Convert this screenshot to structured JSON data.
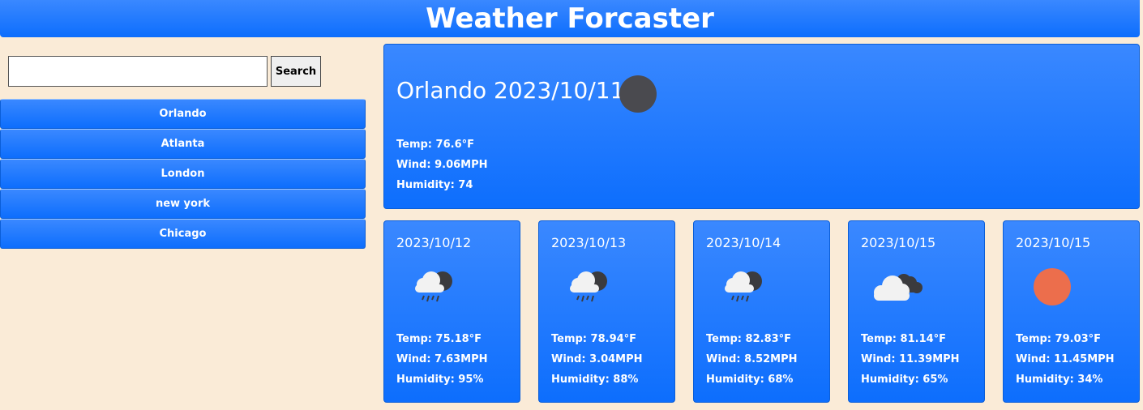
{
  "header": {
    "title": "Weather Forcaster"
  },
  "search": {
    "value": "",
    "placeholder": "",
    "button_label": "Search"
  },
  "history": [
    "Orlando",
    "Atlanta",
    "London",
    "new york",
    "Chicago"
  ],
  "current": {
    "title": "Orlando 2023/10/11",
    "icon": "dark-circle-icon",
    "temp": "Temp: 76.6°F",
    "wind": "Wind: 9.06MPH",
    "humidity": "Humidity: 74"
  },
  "forecast": [
    {
      "date": "2023/10/12",
      "icon": "rain-cloud-icon",
      "temp": "Temp: 75.18°F",
      "wind": "Wind: 7.63MPH",
      "humidity": "Humidity: 95%"
    },
    {
      "date": "2023/10/13",
      "icon": "rain-cloud-icon",
      "temp": "Temp: 78.94°F",
      "wind": "Wind: 3.04MPH",
      "humidity": "Humidity: 88%"
    },
    {
      "date": "2023/10/14",
      "icon": "rain-cloud-icon",
      "temp": "Temp: 82.83°F",
      "wind": "Wind: 8.52MPH",
      "humidity": "Humidity: 68%"
    },
    {
      "date": "2023/10/15",
      "icon": "clouds-icon",
      "temp": "Temp: 81.14°F",
      "wind": "Wind: 11.39MPH",
      "humidity": "Humidity: 65%"
    },
    {
      "date": "2023/10/15",
      "icon": "sun-icon",
      "temp": "Temp: 79.03°F",
      "wind": "Wind: 11.45MPH",
      "humidity": "Humidity: 34%"
    }
  ],
  "colors": {
    "accent": "#0d6efd",
    "background": "#faebd7",
    "sun": "#ec6e4c",
    "dark_icon": "#4a4a4f"
  }
}
